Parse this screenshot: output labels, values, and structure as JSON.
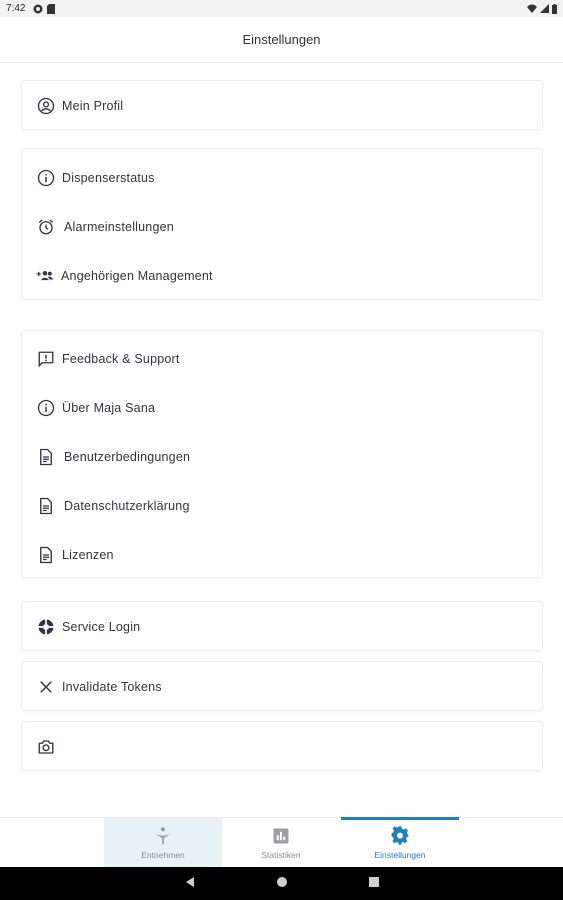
{
  "status_bar": {
    "time": "7:42"
  },
  "app_bar": {
    "title": "Einstellungen"
  },
  "groups": {
    "profile": {
      "mein_profil": "Mein Profil"
    },
    "device": {
      "dispenserstatus": "Dispenserstatus",
      "alarmeinstellungen": "Alarmeinstellungen",
      "angehoerigen": "Angehörigen Management"
    },
    "info": {
      "feedback": "Feedback & Support",
      "ueber": "Über Maja Sana",
      "benutzerbedingungen": "Benutzerbedingungen",
      "datenschutz": "Datenschutzerklärung",
      "lizenzen": "Lizenzen"
    },
    "service": {
      "service_login": "Service Login"
    },
    "tokens": {
      "invalidate": "Invalidate Tokens"
    },
    "camera": {
      "icon": "camera-icon"
    }
  },
  "bottom_nav": {
    "entnehmen": "Entnehmen",
    "statistiken": "Statistiken",
    "einstellungen": "Einstellungen"
  },
  "colors": {
    "accent": "#1f7fbf",
    "inactive": "#8a8f96",
    "text": "#2f3540"
  }
}
